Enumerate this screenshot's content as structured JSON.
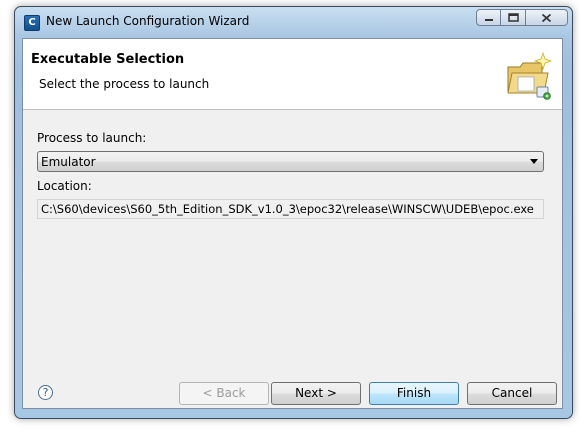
{
  "window": {
    "title": "New Launch Configuration Wizard",
    "app_icon_glyph": "C"
  },
  "banner": {
    "title": "Executable Selection",
    "description": "Select the process to launch",
    "icon": "folder-sparkle-icon"
  },
  "form": {
    "process_label": "Process to launch:",
    "process_value": "Emulator",
    "location_label": "Location:",
    "location_value": "C:\\S60\\devices\\S60_5th_Edition_SDK_v1.0_3\\epoc32\\release\\WINSCW\\UDEB\\epoc.exe"
  },
  "buttons": {
    "back": "< Back",
    "next": "Next >",
    "finish": "Finish",
    "cancel": "Cancel",
    "help_glyph": "?"
  },
  "colors": {
    "frame_accent": "#a9c6e2",
    "default_button_border": "#3c7fb1"
  }
}
